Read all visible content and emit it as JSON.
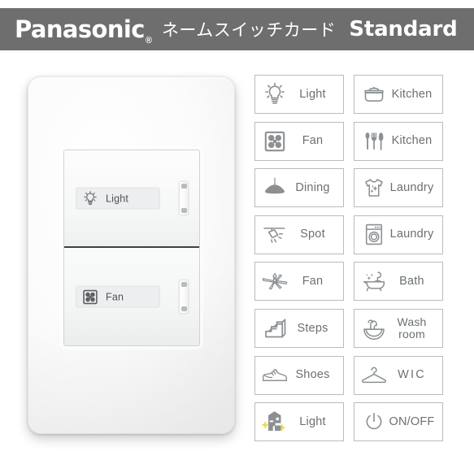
{
  "header": {
    "brand": "Panasonic",
    "registered_mark": "®",
    "product_jp": "ネームスイッチカード",
    "product_en": "Standard",
    "background_color": "#6e6e6e",
    "text_color": "#ffffff"
  },
  "switch_plate": {
    "name": "panasonic-name-switch-plate",
    "rockers": [
      {
        "position": "top",
        "icon": "light-bulb-icon",
        "label": "Light"
      },
      {
        "position": "bottom",
        "icon": "fan-vent-icon",
        "label": "Fan"
      }
    ]
  },
  "card_grid": {
    "columns": 2,
    "rows": 9,
    "border_color": "#b9bcbd",
    "label_color": "#6b7073",
    "accent_color": "#f2d94e",
    "cards": [
      {
        "icon": "light-bulb-icon",
        "label": "Light",
        "lines": [
          "Light"
        ]
      },
      {
        "icon": "cooking-pot-icon",
        "label": "Kitchen",
        "lines": [
          "Kitchen"
        ]
      },
      {
        "icon": "fan-vent-icon",
        "label": "Fan",
        "lines": [
          "Fan"
        ]
      },
      {
        "icon": "cutlery-icon",
        "label": "Kitchen",
        "lines": [
          "Kitchen"
        ]
      },
      {
        "icon": "pendant-lamp-icon",
        "label": "Dining",
        "lines": [
          "Dining"
        ]
      },
      {
        "icon": "tshirt-sparkle-icon",
        "label": "Laundry",
        "lines": [
          "Laundry"
        ]
      },
      {
        "icon": "spotlight-icon",
        "label": "Spot",
        "lines": [
          "Spot"
        ]
      },
      {
        "icon": "washing-machine-icon",
        "label": "Laundry",
        "lines": [
          "Laundry"
        ]
      },
      {
        "icon": "ceiling-fan-icon",
        "label": "Fan",
        "lines": [
          "Fan"
        ]
      },
      {
        "icon": "bathtub-icon",
        "label": "Bath",
        "lines": [
          "Bath"
        ]
      },
      {
        "icon": "stairs-icon",
        "label": "Steps",
        "lines": [
          "Steps"
        ]
      },
      {
        "icon": "sink-faucet-icon",
        "label": "Wash room",
        "lines": [
          "Wash",
          "room"
        ]
      },
      {
        "icon": "sneaker-icon",
        "label": "Shoes",
        "lines": [
          "Shoes"
        ]
      },
      {
        "icon": "clothes-hanger-icon",
        "label": "WIC",
        "lines": [
          "WIC"
        ]
      },
      {
        "icon": "house-sparkle-icon",
        "label": "Light",
        "lines": [
          "Light"
        ]
      },
      {
        "icon": "power-icon",
        "label": "ON/OFF",
        "lines": [
          "ON/OFF"
        ]
      }
    ]
  }
}
